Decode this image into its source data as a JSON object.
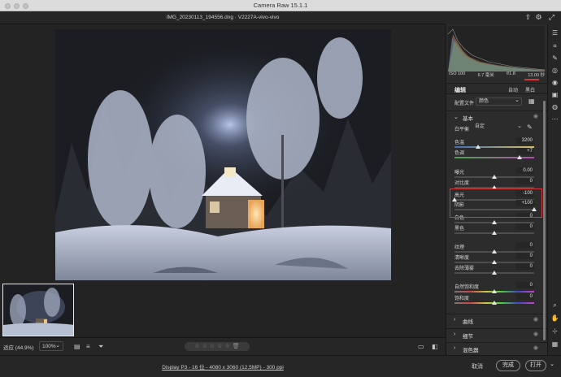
{
  "window": {
    "title": "Camera Raw 15.1.1"
  },
  "file": {
    "name": "IMG_20230113_194556.dng  ·  V2227A-vivo-vivo"
  },
  "exif": {
    "iso": "ISO 100",
    "focal": "6.7 毫米",
    "aperture": "f/1.8",
    "shutter": "13.00 秒"
  },
  "panel": {
    "edit_label": "编辑",
    "auto_label": "自动",
    "bw_label": "黑白",
    "profile_label": "配置文件",
    "profile_value": "颜色",
    "basic_section": "基本",
    "wb_label": "白平衡",
    "wb_value": "自定"
  },
  "sliders": {
    "temp": {
      "label": "色温",
      "value": "3200"
    },
    "tint": {
      "label": "色调",
      "value": "+7"
    },
    "exposure": {
      "label": "曝光",
      "value": "0.00"
    },
    "contrast": {
      "label": "对比度",
      "value": "0"
    },
    "highlights": {
      "label": "高光",
      "value": "-100"
    },
    "shadows": {
      "label": "阴影",
      "value": "+100"
    },
    "whites": {
      "label": "白色",
      "value": "0"
    },
    "blacks": {
      "label": "黑色",
      "value": "0"
    },
    "texture": {
      "label": "纹理",
      "value": "0"
    },
    "clarity": {
      "label": "清晰度",
      "value": "0"
    },
    "dehaze": {
      "label": "去除薄雾",
      "value": "0"
    },
    "vibrance": {
      "label": "自然饱和度",
      "value": "0"
    },
    "saturation": {
      "label": "饱和度",
      "value": "0"
    }
  },
  "slider_levels": {
    "temp": 0.3,
    "tint": 0.82,
    "exposure": 0.5,
    "contrast": 0.5,
    "highlights": 0.0,
    "shadows": 1.0,
    "whites": 0.5,
    "blacks": 0.5,
    "texture": 0.5,
    "clarity": 0.5,
    "dehaze": 0.5,
    "vibrance": 0.5,
    "saturation": 0.5
  },
  "sections": {
    "curve": "曲线",
    "detail": "细节",
    "color_mixer": "混色器"
  },
  "status": {
    "fit": "适应 (44.9%)",
    "zoom": "100%"
  },
  "footer": {
    "info": "Display P3 - 16 位 - 4080 x 3060 (12.5MP) - 300 ppi",
    "cancel": "取消",
    "done": "完成",
    "open": "打开"
  },
  "colors": {
    "accent": "#d63a3a",
    "panel_bg": "#2c2c2c"
  }
}
